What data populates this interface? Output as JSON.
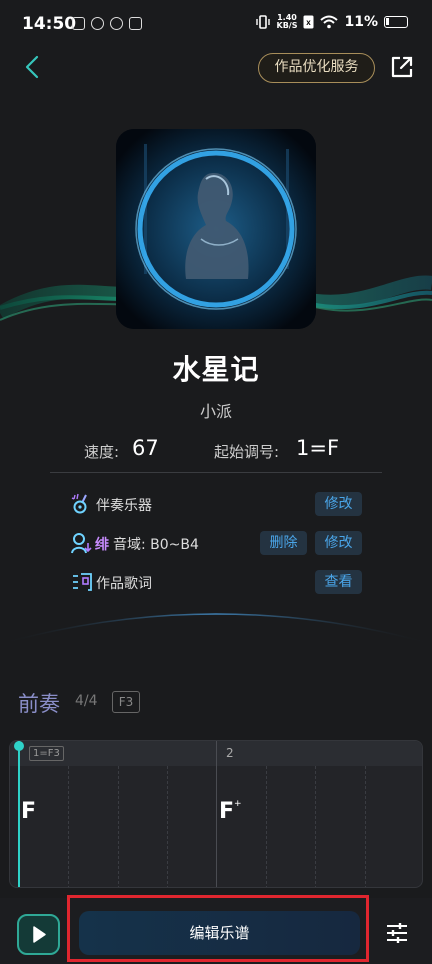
{
  "status_bar": {
    "time": "14:50",
    "net_speed_value": "1.40",
    "net_speed_unit": "KB/S",
    "battery": "11%"
  },
  "header": {
    "service_button": "作品优化服务"
  },
  "song": {
    "title": "水星记",
    "artist": "小派",
    "tempo_label": "速度:",
    "tempo_value": "67",
    "key_label": "起始调号:",
    "key_value": "1=F"
  },
  "settings": {
    "accompaniment_label": "伴奏乐器",
    "accompaniment_action": "修改",
    "range_prefix": "绯",
    "range_label": "音域: B0~B4",
    "range_delete": "删除",
    "range_edit": "修改",
    "lyrics_label": "作品歌词",
    "lyrics_action": "查看"
  },
  "section": {
    "title": "前奏",
    "count": "4/4",
    "key_tag": "F3"
  },
  "score": {
    "key_marker": "1=F3",
    "measures": [
      {
        "number": "",
        "chord": "F",
        "mark": ""
      },
      {
        "number": "2",
        "chord": "F",
        "mark": "+"
      }
    ]
  },
  "bottom": {
    "edit_button": "编辑乐谱"
  },
  "colors": {
    "accent_teal": "#2fd3c9",
    "link_blue": "#4aa5e8",
    "section_title": "#8a8ec8",
    "highlight_red": "#e0262f"
  },
  "icons": [
    "back-icon",
    "share-icon",
    "guitar-icon",
    "voice-range-icon",
    "lyrics-icon",
    "play-icon",
    "adjust-icon"
  ]
}
